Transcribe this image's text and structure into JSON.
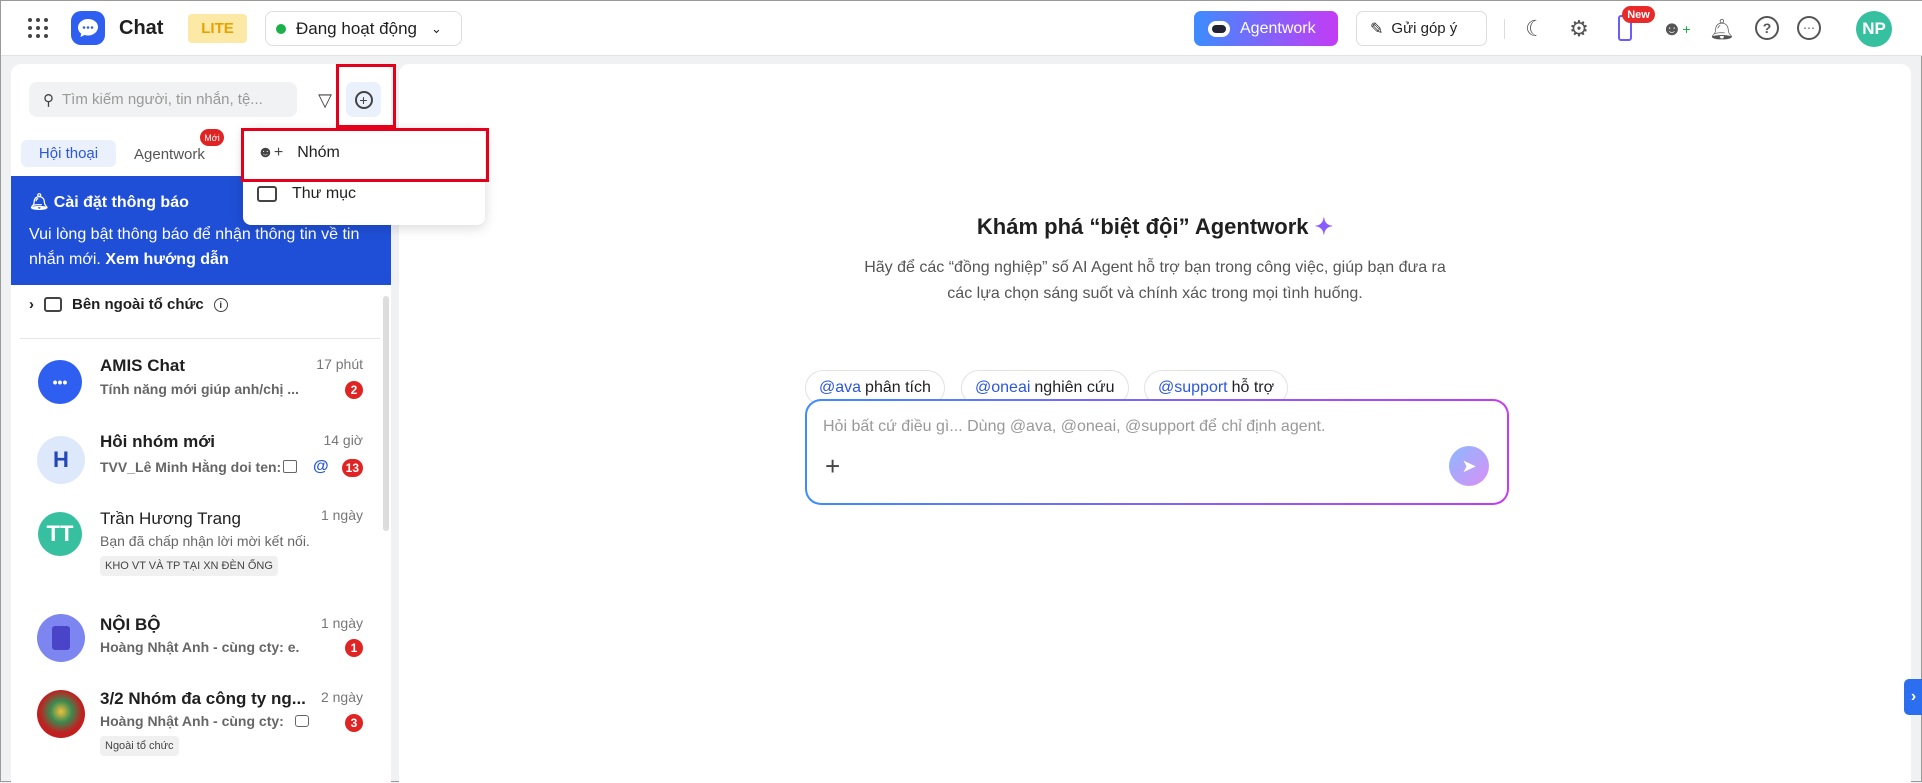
{
  "header": {
    "app_title": "Chat",
    "plan_badge": "LITE",
    "status": "Đang hoạt động",
    "agentwork_button": "Agentwork",
    "feedback_button": "Gửi góp ý",
    "new_badge": "New",
    "avatar_initials": "NP"
  },
  "sidebar": {
    "search_placeholder": "Tìm kiếm người, tin nhắn, tệ...",
    "tabs": [
      {
        "label": "Hội thoại"
      },
      {
        "label": "Agentwork",
        "badge": "Mới"
      }
    ],
    "notice": {
      "title": "Cài đặt thông báo",
      "text": "Vui lòng bật thông báo để nhận thông tin về tin nhắn mới.",
      "link": "Xem hướng dẫn"
    },
    "folder": "Bên ngoài tổ chức",
    "conversations": [
      {
        "name": "AMIS Chat",
        "time": "17 phút",
        "preview": "Tính năng mới giúp anh/chị ...",
        "unread": "2"
      },
      {
        "name": "Hôi nhóm mới",
        "time": "14 giờ",
        "preview": "TVV_Lê Minh Hằng doi ten:",
        "unread": "13",
        "avatar": "H",
        "mention": "@"
      },
      {
        "name": "Trần Hương Trang",
        "time": "1 ngày",
        "preview": "Bạn đã chấp nhận lời mời kết nối.",
        "avatar": "TT",
        "tag": "KHO VT VÀ TP TẠI XN ĐÈN ỐNG"
      },
      {
        "name": "NỘI BỘ",
        "time": "1 ngày",
        "preview": "Hoàng Nhật Anh - cùng cty: e.",
        "unread": "1"
      },
      {
        "name": "3/2 Nhóm đa công ty ng...",
        "time": "2 ngày",
        "preview": "Hoàng Nhật Anh - cùng cty:",
        "unread": "3",
        "tag": "Ngoài tổ chức"
      }
    ]
  },
  "dropdown": {
    "items": [
      {
        "label": "Nhóm"
      },
      {
        "label": "Thư mục"
      }
    ]
  },
  "main": {
    "title": "Khám phá “biệt đội” Agentwork",
    "subtitle_1": "Hãy để các “đồng nghiệp” số AI Agent hỗ trợ bạn trong công việc, giúp bạn đưa ra",
    "subtitle_2": "các lựa chọn sáng suốt và chính xác trong mọi tình huống.",
    "chips": [
      {
        "mention": "@ava",
        "text": "phân tích"
      },
      {
        "mention": "@oneai",
        "text": "nghiên cứu"
      },
      {
        "mention": "@support",
        "text": "hỗ trợ"
      }
    ],
    "input_placeholder": "Hỏi bất cứ điều gì... Dùng @ava, @oneai, @support để chỉ định agent."
  }
}
